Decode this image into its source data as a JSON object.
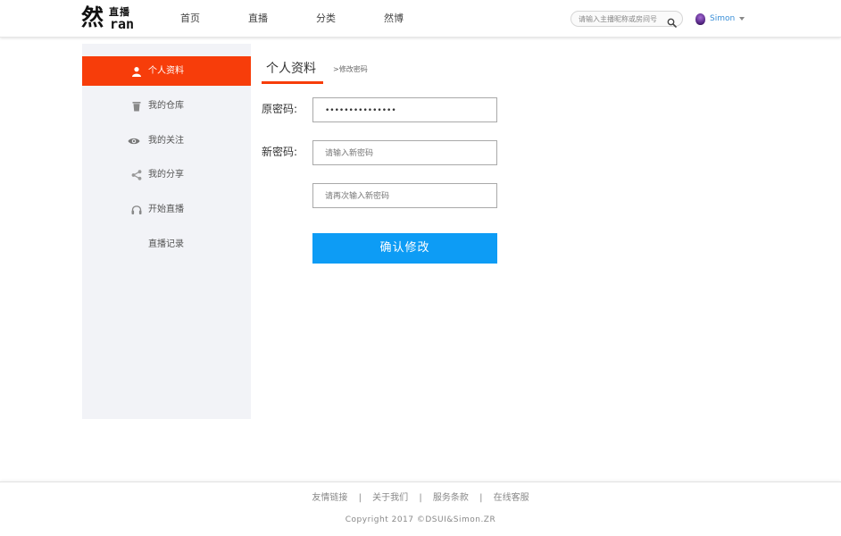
{
  "header": {
    "logo": {
      "big": "然",
      "small_top": "直播",
      "small_bottom": "ran"
    },
    "nav": [
      {
        "label": "首页"
      },
      {
        "label": "直播"
      },
      {
        "label": "分类"
      },
      {
        "label": "然博"
      }
    ],
    "search": {
      "placeholder": "请输入主播昵称或房间号",
      "icon": "search-icon"
    },
    "user": {
      "name": "Simon",
      "avatar": "avatar-icon"
    }
  },
  "sidebar": {
    "items": [
      {
        "label": "个人资料",
        "icon": "person-icon",
        "active": true
      },
      {
        "label": "我的仓库",
        "icon": "trash-icon",
        "active": false
      },
      {
        "label": "我的关注",
        "icon": "eye-icon",
        "active": false
      },
      {
        "label": "我的分享",
        "icon": "share-icon",
        "active": false
      },
      {
        "label": "开始直播",
        "icon": "headphones-icon",
        "active": false
      },
      {
        "label": "直播记录",
        "icon": "",
        "active": false
      }
    ]
  },
  "main": {
    "tab_title": "个人资料",
    "breadcrumb": ">修改密码",
    "old_password": {
      "label": "原密码:",
      "value": "•••••••••••••••"
    },
    "new_password": {
      "label": "新密码:",
      "placeholder": "请输入新密码"
    },
    "confirm_password": {
      "placeholder": "请再次输入新密码"
    },
    "submit_label": "确认修改"
  },
  "footer": {
    "links": [
      {
        "label": "友情链接"
      },
      {
        "label": "关于我们"
      },
      {
        "label": "服务条款"
      },
      {
        "label": "在线客服"
      }
    ],
    "separator": "|",
    "copyright": "Copyright 2017 ©DSUI&Simon.ZR"
  },
  "colors": {
    "accent": "#f73d0a",
    "button": "#0d9cf5",
    "username": "#3a8fd8",
    "sidebar_bg": "#f2f3f7"
  }
}
